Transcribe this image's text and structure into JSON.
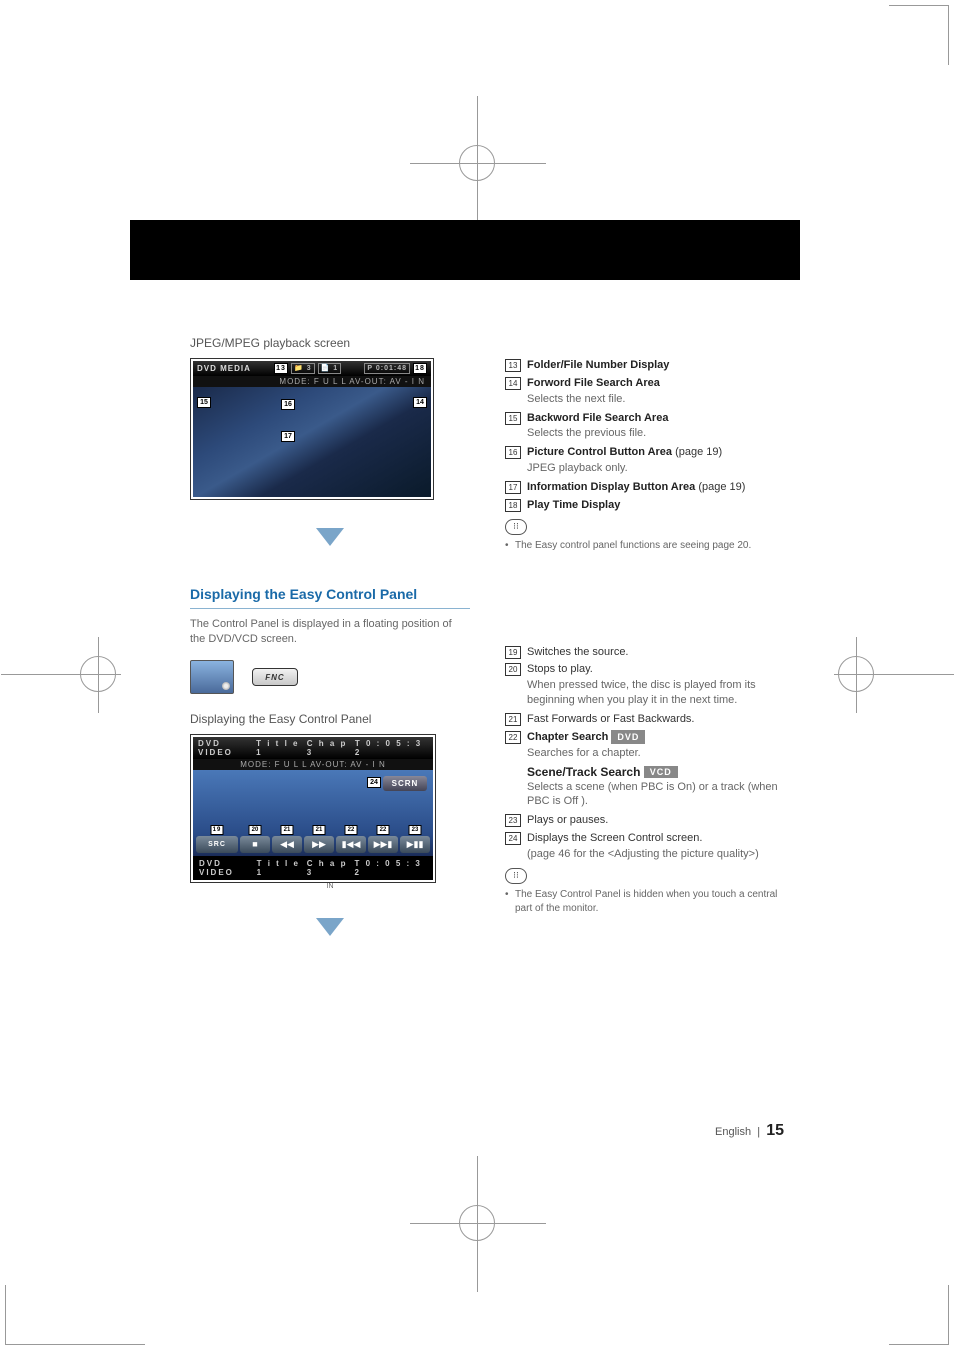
{
  "header": {
    "jpeg_caption": "JPEG/MPEG playback screen"
  },
  "screen1": {
    "title": "DVD MEDIA",
    "folder_icon": "3",
    "file_icon": "1",
    "p_time": "P   0:01:48",
    "mode": "MODE: F U L L    AV-OUT: AV - I N"
  },
  "callouts1": {
    "c13": "13",
    "c14": "14",
    "c15": "15",
    "c16": "16",
    "c17": "17",
    "c18": "18"
  },
  "list1": [
    {
      "idx": "13",
      "bold": "Folder/File Number Display"
    },
    {
      "idx": "14",
      "bold": "Forword File Search Area",
      "sub": "Selects the next file."
    },
    {
      "idx": "15",
      "bold": "Backword File Search Area",
      "sub": "Selects the previous file."
    },
    {
      "idx": "16",
      "bold": "Picture Control Button Area",
      "tail": " (page 19)",
      "sub": "JPEG playback only."
    },
    {
      "idx": "17",
      "bold": "Information Display Button Area",
      "tail": " (page 19)"
    },
    {
      "idx": "18",
      "bold": "Play Time Display"
    }
  ],
  "note1": "The Easy control panel functions are seeing page 20.",
  "section": {
    "title": "Displaying the Easy Control Panel",
    "desc": "The Control Panel is displayed in a floating position of the DVD/VCD screen.",
    "fnc_label": "FNC",
    "caption2": "Displaying the Easy Control Panel"
  },
  "screen2": {
    "title": "DVD VIDEO",
    "title_no": "T i t l e   1",
    "chap": "C h a p   3",
    "time": "T   0 : 0 5 : 3 2",
    "mode": "MODE: F U L L   AV-OUT: AV - I N",
    "scrn": "SCRN",
    "src": "SRC",
    "in": "IN"
  },
  "callouts2": {
    "c19": "19",
    "c20": "20",
    "c21": "21",
    "c22": "22",
    "c23": "23",
    "c24": "24"
  },
  "list2": [
    {
      "idx": "19",
      "txt": "Switches the source."
    },
    {
      "idx": "20",
      "txt": "Stops to play.",
      "sub": "When pressed twice, the disc is played from its beginning when you play it in the next time."
    },
    {
      "idx": "21",
      "txt": "Fast Forwards or Fast Backwards."
    },
    {
      "idx": "22",
      "bold": "Chapter Search",
      "badge": "DVD",
      "sub": "Searches for a chapter.",
      "bold2": "Scene/Track Search",
      "badge2": "VCD",
      "sub2": "Selects a scene (when PBC is On) or a track (when PBC is Off )."
    },
    {
      "idx": "23",
      "txt": "Plays or pauses."
    },
    {
      "idx": "24",
      "txt": "Displays the Screen Control screen.",
      "sub": "(page 46 for the <Adjusting the picture quality>)"
    }
  ],
  "note2": "The Easy Control Panel is hidden when you touch a central part of the monitor.",
  "footer": {
    "lang": "English",
    "page": "15"
  }
}
